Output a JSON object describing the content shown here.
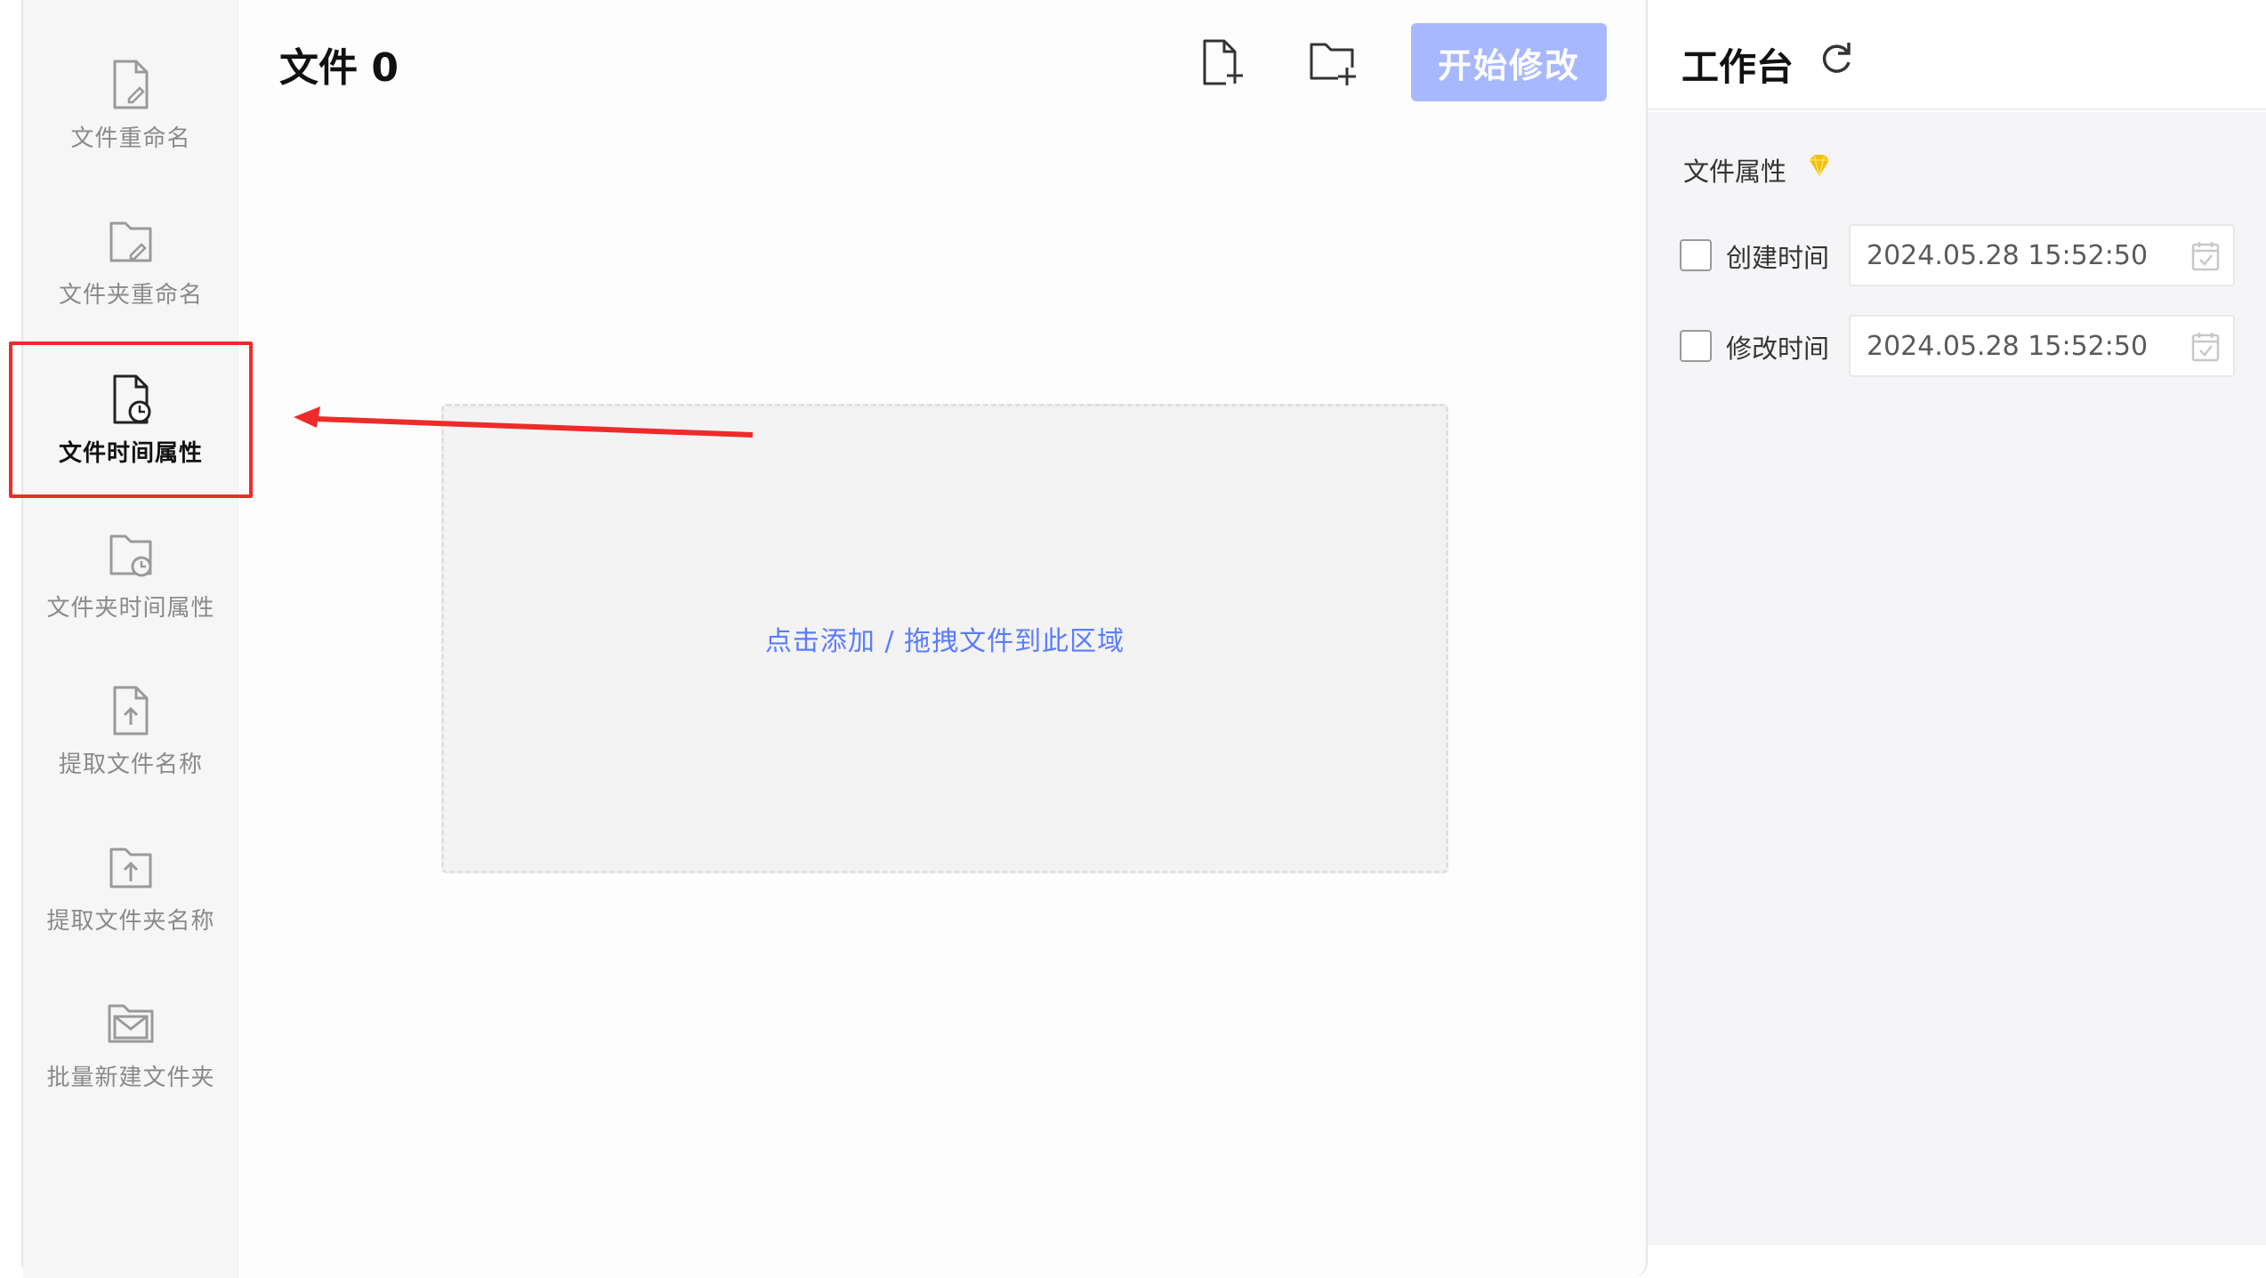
{
  "sidebar": {
    "items": [
      {
        "label": "文件重命名",
        "icon": "file-edit-icon"
      },
      {
        "label": "文件夹重命名",
        "icon": "folder-edit-icon"
      },
      {
        "label": "文件时间属性",
        "icon": "file-clock-icon",
        "active": true
      },
      {
        "label": "文件夹时间属性",
        "icon": "folder-clock-icon"
      },
      {
        "label": "提取文件名称",
        "icon": "file-upload-icon"
      },
      {
        "label": "提取文件夹名称",
        "icon": "folder-upload-icon"
      },
      {
        "label": "批量新建文件夹",
        "icon": "folder-mail-icon"
      }
    ]
  },
  "main": {
    "title": "文件 0",
    "add_file_icon": "add-file-icon",
    "add_folder_icon": "add-folder-icon",
    "start_button": "开始修改",
    "dropzone_text": "点击添加 / 拖拽文件到此区域"
  },
  "workspace": {
    "title": "工作台",
    "refresh_icon": "refresh-icon",
    "section_label": "文件属性",
    "section_icon": "diamond-icon",
    "rows": [
      {
        "label": "创建时间",
        "value": "2024.05.28 15:52:50",
        "checked": false
      },
      {
        "label": "修改时间",
        "value": "2024.05.28 15:52:50",
        "checked": false
      }
    ]
  },
  "colors": {
    "accent": "#5b7cff",
    "button_disabled": "#a8b8ff",
    "highlight_border": "#ee2b2b",
    "premium": "#f5c000"
  }
}
